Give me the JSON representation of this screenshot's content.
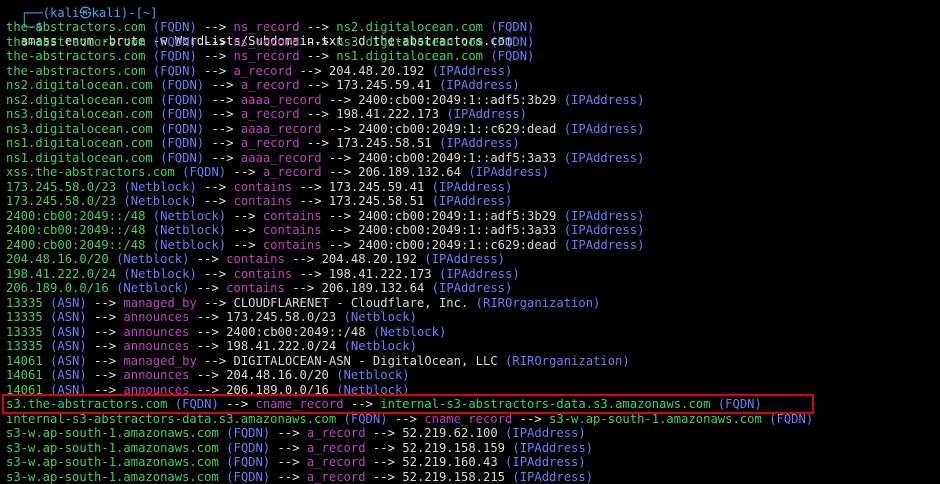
{
  "terminal": {
    "prompt_symbol": "└─$",
    "command": "amass enum -brute -w WordLists/Subdomain.txt -d the-abstractors.com",
    "partial_top": "┌──(kali㉿kali)-[~]"
  },
  "lines": [
    [
      "the-abstractors.com",
      "(FQDN)",
      "-->",
      "ns_record",
      "-->",
      "ns2.digitalocean.com",
      "(FQDN)"
    ],
    [
      "the-abstractors.com",
      "(FQDN)",
      "-->",
      "ns_record",
      "-->",
      "ns3.digitalocean.com",
      "(FQDN)"
    ],
    [
      "the-abstractors.com",
      "(FQDN)",
      "-->",
      "ns_record",
      "-->",
      "ns1.digitalocean.com",
      "(FQDN)"
    ],
    [
      "the-abstractors.com",
      "(FQDN)",
      "-->",
      "a_record",
      "-->",
      "204.48.20.192",
      "(IPAddress)"
    ],
    [
      "ns2.digitalocean.com",
      "(FQDN)",
      "-->",
      "a_record",
      "-->",
      "173.245.59.41",
      "(IPAddress)"
    ],
    [
      "ns2.digitalocean.com",
      "(FQDN)",
      "-->",
      "aaaa_record",
      "-->",
      "2400:cb00:2049:1::adf5:3b29",
      "(IPAddress)"
    ],
    [
      "ns3.digitalocean.com",
      "(FQDN)",
      "-->",
      "a_record",
      "-->",
      "198.41.222.173",
      "(IPAddress)"
    ],
    [
      "ns3.digitalocean.com",
      "(FQDN)",
      "-->",
      "aaaa_record",
      "-->",
      "2400:cb00:2049:1::c629:dead",
      "(IPAddress)"
    ],
    [
      "ns1.digitalocean.com",
      "(FQDN)",
      "-->",
      "a_record",
      "-->",
      "173.245.58.51",
      "(IPAddress)"
    ],
    [
      "ns1.digitalocean.com",
      "(FQDN)",
      "-->",
      "aaaa_record",
      "-->",
      "2400:cb00:2049:1::adf5:3a33",
      "(IPAddress)"
    ],
    [
      "xss.the-abstractors.com",
      "(FQDN)",
      "-->",
      "a_record",
      "-->",
      "206.189.132.64",
      "(IPAddress)"
    ],
    [
      "173.245.58.0/23",
      "(Netblock)",
      "-->",
      "contains",
      "-->",
      "173.245.59.41",
      "(IPAddress)"
    ],
    [
      "173.245.58.0/23",
      "(Netblock)",
      "-->",
      "contains",
      "-->",
      "173.245.58.51",
      "(IPAddress)"
    ],
    [
      "2400:cb00:2049::/48",
      "(Netblock)",
      "-->",
      "contains",
      "-->",
      "2400:cb00:2049:1::adf5:3b29",
      "(IPAddress)"
    ],
    [
      "2400:cb00:2049::/48",
      "(Netblock)",
      "-->",
      "contains",
      "-->",
      "2400:cb00:2049:1::adf5:3a33",
      "(IPAddress)"
    ],
    [
      "2400:cb00:2049::/48",
      "(Netblock)",
      "-->",
      "contains",
      "-->",
      "2400:cb00:2049:1::c629:dead",
      "(IPAddress)"
    ],
    [
      "204.48.16.0/20",
      "(Netblock)",
      "-->",
      "contains",
      "-->",
      "204.48.20.192",
      "(IPAddress)"
    ],
    [
      "198.41.222.0/24",
      "(Netblock)",
      "-->",
      "contains",
      "-->",
      "198.41.222.173",
      "(IPAddress)"
    ],
    [
      "206.189.0.0/16",
      "(Netblock)",
      "-->",
      "contains",
      "-->",
      "206.189.132.64",
      "(IPAddress)"
    ],
    [
      "13335",
      "(ASN)",
      "-->",
      "managed_by",
      "-->",
      "CLOUDFLARENET - Cloudflare, Inc.",
      "(RIROrganization)"
    ],
    [
      "13335",
      "(ASN)",
      "-->",
      "announces",
      "-->",
      "173.245.58.0/23",
      "(Netblock)"
    ],
    [
      "13335",
      "(ASN)",
      "-->",
      "announces",
      "-->",
      "2400:cb00:2049::/48",
      "(Netblock)"
    ],
    [
      "13335",
      "(ASN)",
      "-->",
      "announces",
      "-->",
      "198.41.222.0/24",
      "(Netblock)"
    ],
    [
      "14061",
      "(ASN)",
      "-->",
      "managed_by",
      "-->",
      "DIGITALOCEAN-ASN - DigitalOcean, LLC",
      "(RIROrganization)"
    ],
    [
      "14061",
      "(ASN)",
      "-->",
      "announces",
      "-->",
      "204.48.16.0/20",
      "(Netblock)"
    ],
    [
      "14061",
      "(ASN)",
      "-->",
      "announces",
      "-->",
      "206.189.0.0/16",
      "(Netblock)"
    ],
    [
      "s3.the-abstractors.com",
      "(FQDN)",
      "-->",
      "cname_record",
      "-->",
      "internal-s3-abstractors-data.s3.amazonaws.com",
      "(FQDN)"
    ],
    [
      "internal-s3-abstractors-data.s3.amazonaws.com",
      "(FQDN)",
      "-->",
      "cname_record",
      "-->",
      "s3-w.ap-south-1.amazonaws.com",
      "(FQDN)"
    ],
    [
      "s3-w.ap-south-1.amazonaws.com",
      "(FQDN)",
      "-->",
      "a_record",
      "-->",
      "52.219.62.100",
      "(IPAddress)"
    ],
    [
      "s3-w.ap-south-1.amazonaws.com",
      "(FQDN)",
      "-->",
      "a_record",
      "-->",
      "52.219.158.159",
      "(IPAddress)"
    ],
    [
      "s3-w.ap-south-1.amazonaws.com",
      "(FQDN)",
      "-->",
      "a_record",
      "-->",
      "52.219.160.43",
      "(IPAddress)"
    ],
    [
      "s3-w.ap-south-1.amazonaws.com",
      "(FQDN)",
      "-->",
      "a_record",
      "-->",
      "52.219.158.215",
      "(IPAddress)"
    ]
  ],
  "highlight": {
    "line_index": 26,
    "color": "#e00000"
  },
  "colors": {
    "background": "#000000",
    "host": "#3ad35e",
    "tag": "#6d7cff",
    "relation": "#c13fc4",
    "value": "#d9d9d9"
  }
}
